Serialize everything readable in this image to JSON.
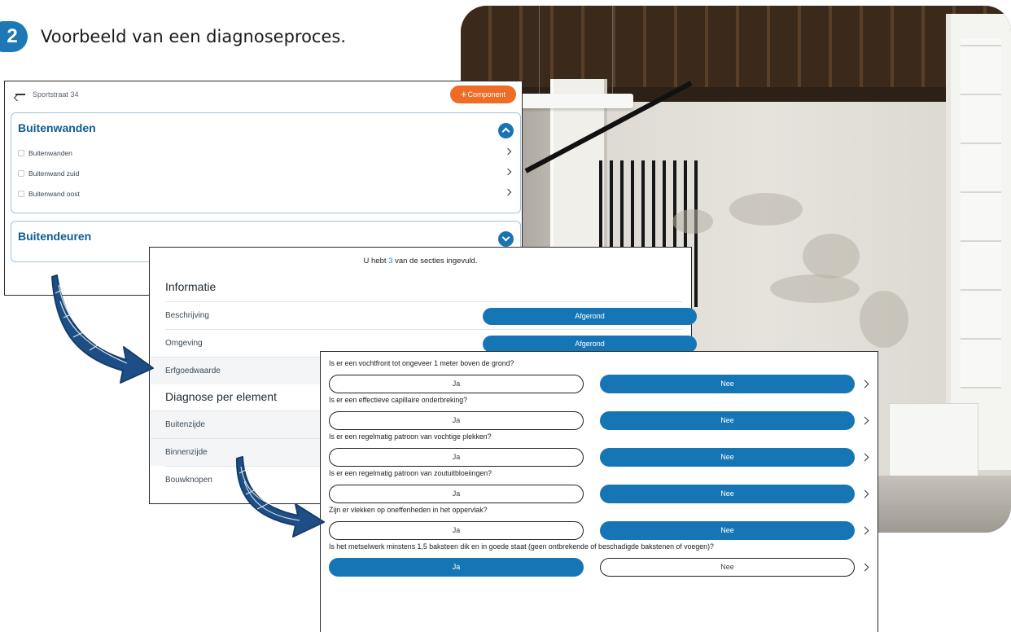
{
  "heading": {
    "step": "2",
    "title": "Voorbeeld van een diagnoseproces."
  },
  "card1": {
    "address": "Sportstraat 34",
    "add_button": "Component",
    "groups": [
      {
        "title": "Buitenwanden",
        "expanded": true,
        "items": [
          "Buitenwanden",
          "Buitenwand zuid",
          "Buitenwand oost"
        ]
      },
      {
        "title": "Buitendeuren",
        "expanded": false,
        "items": []
      }
    ]
  },
  "card2": {
    "status_prefix": "U hebt ",
    "status_count": "3",
    "status_suffix": " van de secties ingevuld.",
    "section1": {
      "title": "Informatie",
      "rows": [
        {
          "label": "Beschrijving",
          "status": "Afgerond"
        },
        {
          "label": "Omgeving",
          "status": "Afgerond"
        },
        {
          "label": "Erfgoedwaarde",
          "status": ""
        }
      ]
    },
    "section2": {
      "title": "Diagnose per element",
      "rows": [
        {
          "label": "Buitenzijde"
        },
        {
          "label": "Binnenzijde"
        },
        {
          "label": "Bouwknopen"
        }
      ]
    }
  },
  "card3": {
    "yes_label": "Ja",
    "no_label": "Nee",
    "questions": [
      {
        "text": "Is er een vochtfront tot ongeveer 1 meter boven de grond?",
        "answer": "Nee"
      },
      {
        "text": "Is er een effectieve capillaire onderbreking?",
        "answer": "Nee"
      },
      {
        "text": "Is er een regelmatig patroon van vochtige plekken?",
        "answer": "Nee"
      },
      {
        "text": "Is er een regelmatig patroon van zoutuitbloeiingen?",
        "answer": "Nee"
      },
      {
        "text": "Zijn er vlekken op oneffenheden in het oppervlak?",
        "answer": "Nee"
      },
      {
        "text": "Is het metselwerk minstens 1,5 baksteen dik en in goede staat (geen ontbrekende of beschadigde bakstenen of voegen)?",
        "answer": "Ja"
      }
    ]
  },
  "colors": {
    "primary": "#1575b5",
    "accent": "#ee6c26",
    "title_blue": "#0e5c93",
    "arrow": "#1d4f86"
  },
  "icons": [
    "back-arrow-icon",
    "plus-icon",
    "chevron-up-icon",
    "chevron-down-icon",
    "chevron-right-icon",
    "curved-arrow-icon"
  ]
}
